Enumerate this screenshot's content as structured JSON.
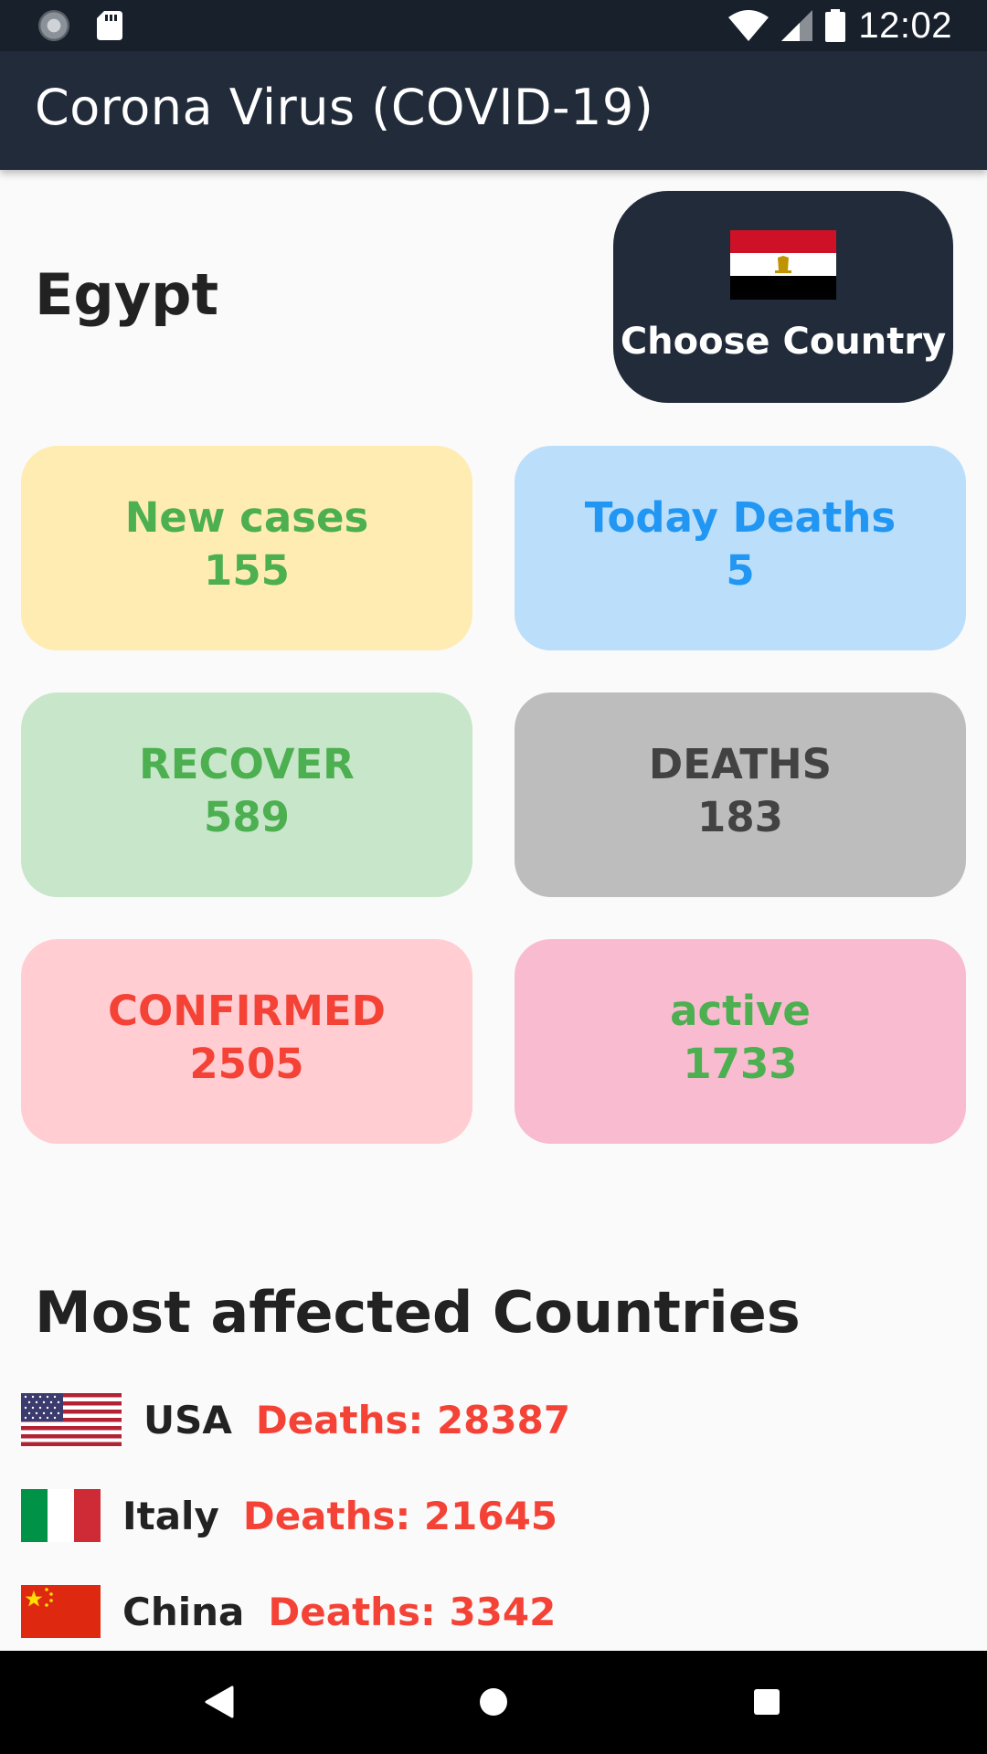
{
  "status_bar": {
    "time": "12:02",
    "left_icons": [
      "loading-icon",
      "sd-card-icon"
    ],
    "right_icons": [
      "wifi-icon",
      "signal-icon",
      "battery-icon"
    ]
  },
  "app_bar": {
    "title": "Corona Virus (COVID-19)"
  },
  "country": {
    "name": "Egypt",
    "choose_button_label": "Choose Country",
    "flag_icon": "egypt-flag-icon"
  },
  "stats": {
    "new_cases": {
      "label": "New cases",
      "value": "155",
      "bg": "#ffecb3",
      "color": "#4caf50"
    },
    "today_deaths": {
      "label": "Today Deaths",
      "value": "5",
      "bg": "#bbdefb",
      "color": "#2196f3"
    },
    "recover": {
      "label": "RECOVER",
      "value": "589",
      "bg": "#c8e6c9",
      "color": "#4caf50"
    },
    "deaths": {
      "label": "DEATHS",
      "value": "183",
      "bg": "#bdbdbd",
      "color": "#424242"
    },
    "confirmed": {
      "label": "CONFIRMED",
      "value": "2505",
      "bg": "#ffcdd2",
      "color": "#f44336"
    },
    "active": {
      "label": "active",
      "value": "1733",
      "bg": "#f8bbd0",
      "color": "#4caf50"
    }
  },
  "most_affected": {
    "title": "Most affected Countries",
    "countries": [
      {
        "name": "USA",
        "deaths": "Deaths: 28387",
        "flag_icon": "usa-flag-icon"
      },
      {
        "name": "Italy",
        "deaths": "Deaths: 21645",
        "flag_icon": "italy-flag-icon"
      },
      {
        "name": "China",
        "deaths": "Deaths: 3342",
        "flag_icon": "china-flag-icon"
      }
    ]
  },
  "nav_bar": {
    "buttons": [
      "back-icon",
      "home-icon",
      "recents-icon"
    ]
  },
  "colors": {
    "app_bar": "#212b3a",
    "status_bar": "#18202c",
    "background": "#fafafa",
    "accent_red": "#f44336"
  }
}
